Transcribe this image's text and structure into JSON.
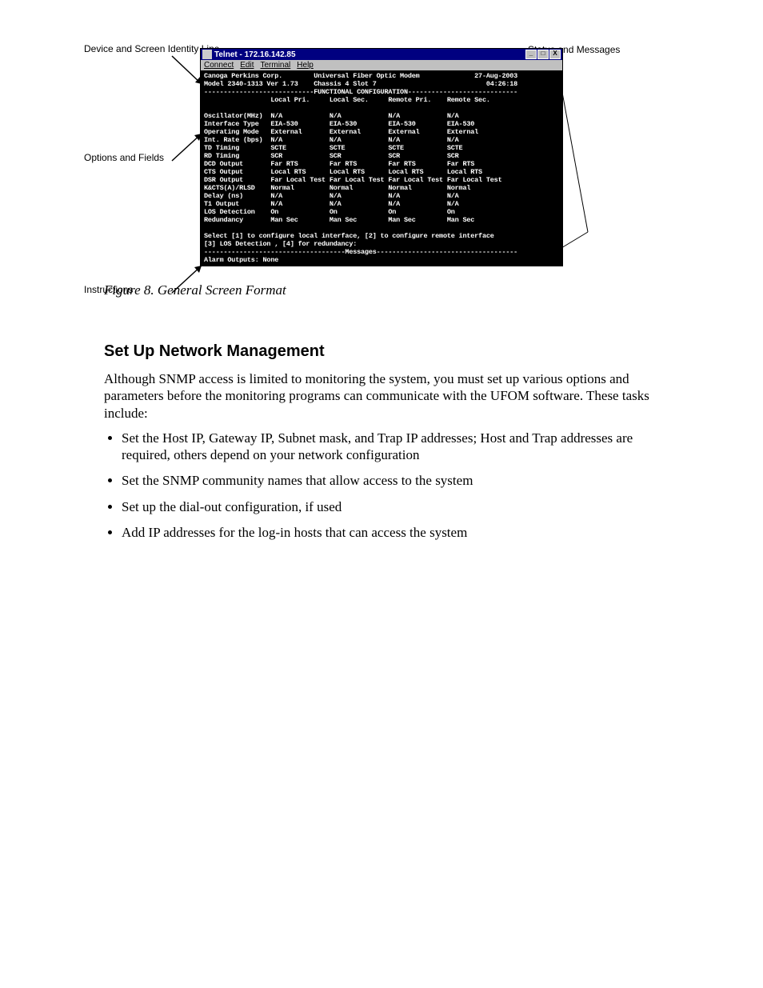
{
  "annotations": {
    "device": "Device and Screen Identity Line",
    "options": "Options and Fields",
    "status": "Status and Messages",
    "instructions": "Instructions"
  },
  "titlebar": {
    "text": "Telnet - 172.16.142.85",
    "min": "_",
    "max": "□",
    "close": "X"
  },
  "menubar": {
    "connect": "Connect",
    "edit": "Edit",
    "terminal": "Terminal",
    "help": "Help"
  },
  "terminal": {
    "line1_corp": "Canoga Perkins Corp.",
    "line1_desc": "Universal Fiber Optic Modem",
    "line1_date": "27-Aug-2003",
    "line2_model": "Model 2340-1313 Ver 1.73",
    "line2_slot": "Chassis 4 Slot 7",
    "line2_time": "04:26:18",
    "divider1": "----------------------------FUNCTIONAL CONFIGURATION----------------------------",
    "col1": "Local Pri.",
    "col2": "Local Sec.",
    "col3": "Remote Pri.",
    "col4": "Remote Sec.",
    "rows": [
      {
        "label": "Oscillator(MHz)",
        "c1": "N/A",
        "c2": "N/A",
        "c3": "N/A",
        "c4": "N/A"
      },
      {
        "label": "Interface Type",
        "c1": "EIA-530",
        "c2": "EIA-530",
        "c3": "EIA-530",
        "c4": "EIA-530"
      },
      {
        "label": "Operating Mode",
        "c1": "External",
        "c2": "External",
        "c3": "External",
        "c4": "External"
      },
      {
        "label": "Int. Rate (bps)",
        "c1": "N/A",
        "c2": "N/A",
        "c3": "N/A",
        "c4": "N/A"
      },
      {
        "label": "TD Timing",
        "c1": "SCTE",
        "c2": "SCTE",
        "c3": "SCTE",
        "c4": "SCTE"
      },
      {
        "label": "RD Timing",
        "c1": "SCR",
        "c2": "SCR",
        "c3": "SCR",
        "c4": "SCR"
      },
      {
        "label": "DCD Output",
        "c1": "Far RTS",
        "c2": "Far RTS",
        "c3": "Far RTS",
        "c4": "Far RTS"
      },
      {
        "label": "CTS Output",
        "c1": "Local RTS",
        "c2": "Local RTS",
        "c3": "Local RTS",
        "c4": "Local RTS"
      },
      {
        "label": "DSR Output",
        "c1": "Far Local Test",
        "c2": "Far Local Test",
        "c3": "Far Local Test",
        "c4": "Far Local Test"
      },
      {
        "label": "K&CTS(A)/RLSD",
        "c1": "Normal",
        "c2": "Normal",
        "c3": "Normal",
        "c4": "Normal"
      },
      {
        "label": "Delay (ns)",
        "c1": "N/A",
        "c2": "N/A",
        "c3": "N/A",
        "c4": "N/A"
      },
      {
        "label": "T1 Output",
        "c1": "N/A",
        "c2": "N/A",
        "c3": "N/A",
        "c4": "N/A"
      },
      {
        "label": "LOS Detection",
        "c1": "On",
        "c2": "On",
        "c3": "On",
        "c4": "On"
      },
      {
        "label": "Redundancy",
        "c1": "Man Sec",
        "c2": "Man Sec",
        "c3": "Man Sec",
        "c4": "Man Sec"
      }
    ],
    "instr1": "Select [1] to configure local interface, [2] to configure remote interface",
    "instr2": "[3] LOS Detection , [4] for redundancy:",
    "divider2": "------------------------------------Messages------------------------------------",
    "alarm": "Alarm Outputs: None"
  },
  "caption": "Figure 8.  General Screen Format",
  "section": {
    "heading": "Set Up Network Management",
    "para": "Although SNMP access is limited to monitoring the system, you must set up various options and parameters before the monitoring programs can communicate with the UFOM software. These tasks include:",
    "bullets": [
      "Set the Host IP, Gateway IP, Subnet mask, and Trap IP addresses; Host and Trap addresses are required, others depend on your network configuration",
      "Set the SNMP community names that allow access to the system",
      "Set up the dial-out configuration, if used",
      "Add IP addresses for the log-in hosts that can access the system"
    ]
  }
}
